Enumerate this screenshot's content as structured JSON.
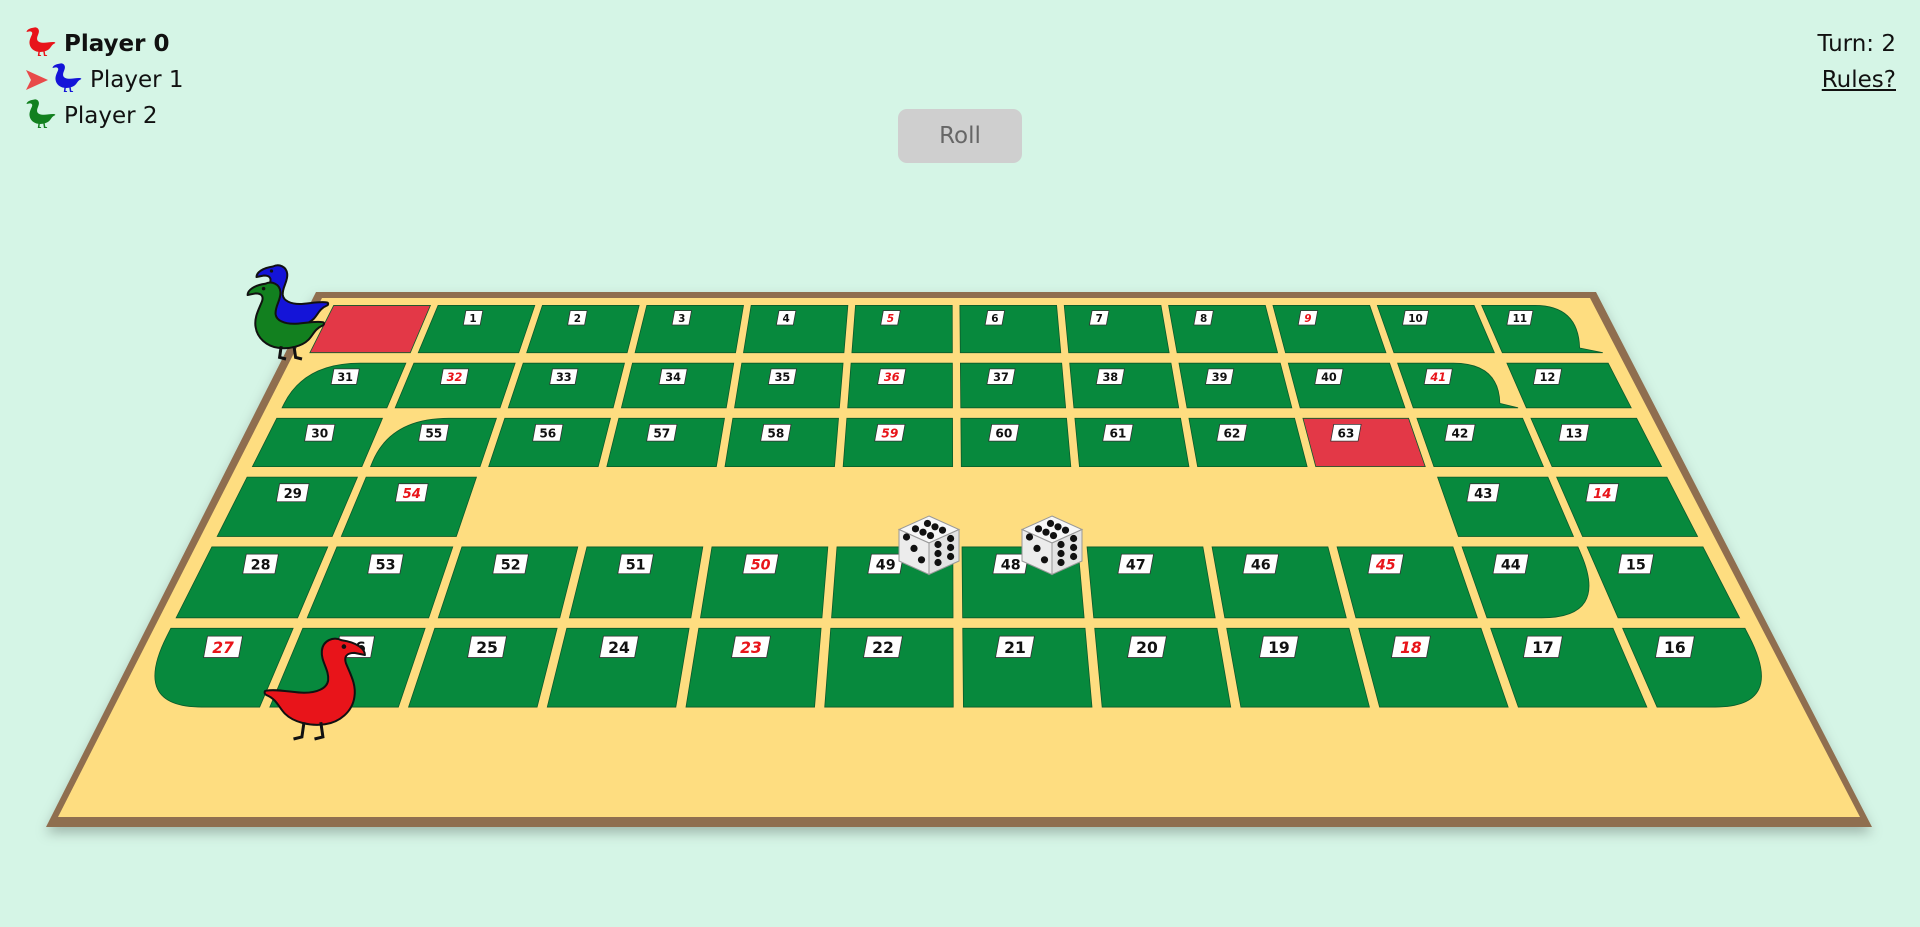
{
  "players": [
    {
      "name": "Player 0",
      "color": "#e8141a",
      "active": true,
      "current_turn": false
    },
    {
      "name": "Player 1",
      "color": "#1414d8",
      "active": false,
      "current_turn": true
    },
    {
      "name": "Player 2",
      "color": "#12801f",
      "active": false,
      "current_turn": false
    }
  ],
  "turn_label": "Turn: 2",
  "rules_label": "Rules?",
  "roll_label": "Roll",
  "dice": [
    6,
    6
  ],
  "icons": {
    "turn_indicator": "arrow-right-icon",
    "player_piece": "goose-icon"
  },
  "colors": {
    "background": "#d5f5e6",
    "board_fill": "#fedd80",
    "board_edge": "#8f6e4f",
    "cell_green": "#07893d",
    "special_red": "#e33847",
    "label_red": "#e8141a",
    "arrow_red": "#e84a4a"
  },
  "board": {
    "red_numbers": [
      5,
      9,
      14,
      18,
      23,
      27,
      32,
      36,
      41,
      45,
      50,
      54,
      59
    ],
    "special_cells": [
      0,
      63
    ],
    "piece_positions": {
      "player0": 26,
      "player1": 0,
      "player2": 0
    }
  }
}
